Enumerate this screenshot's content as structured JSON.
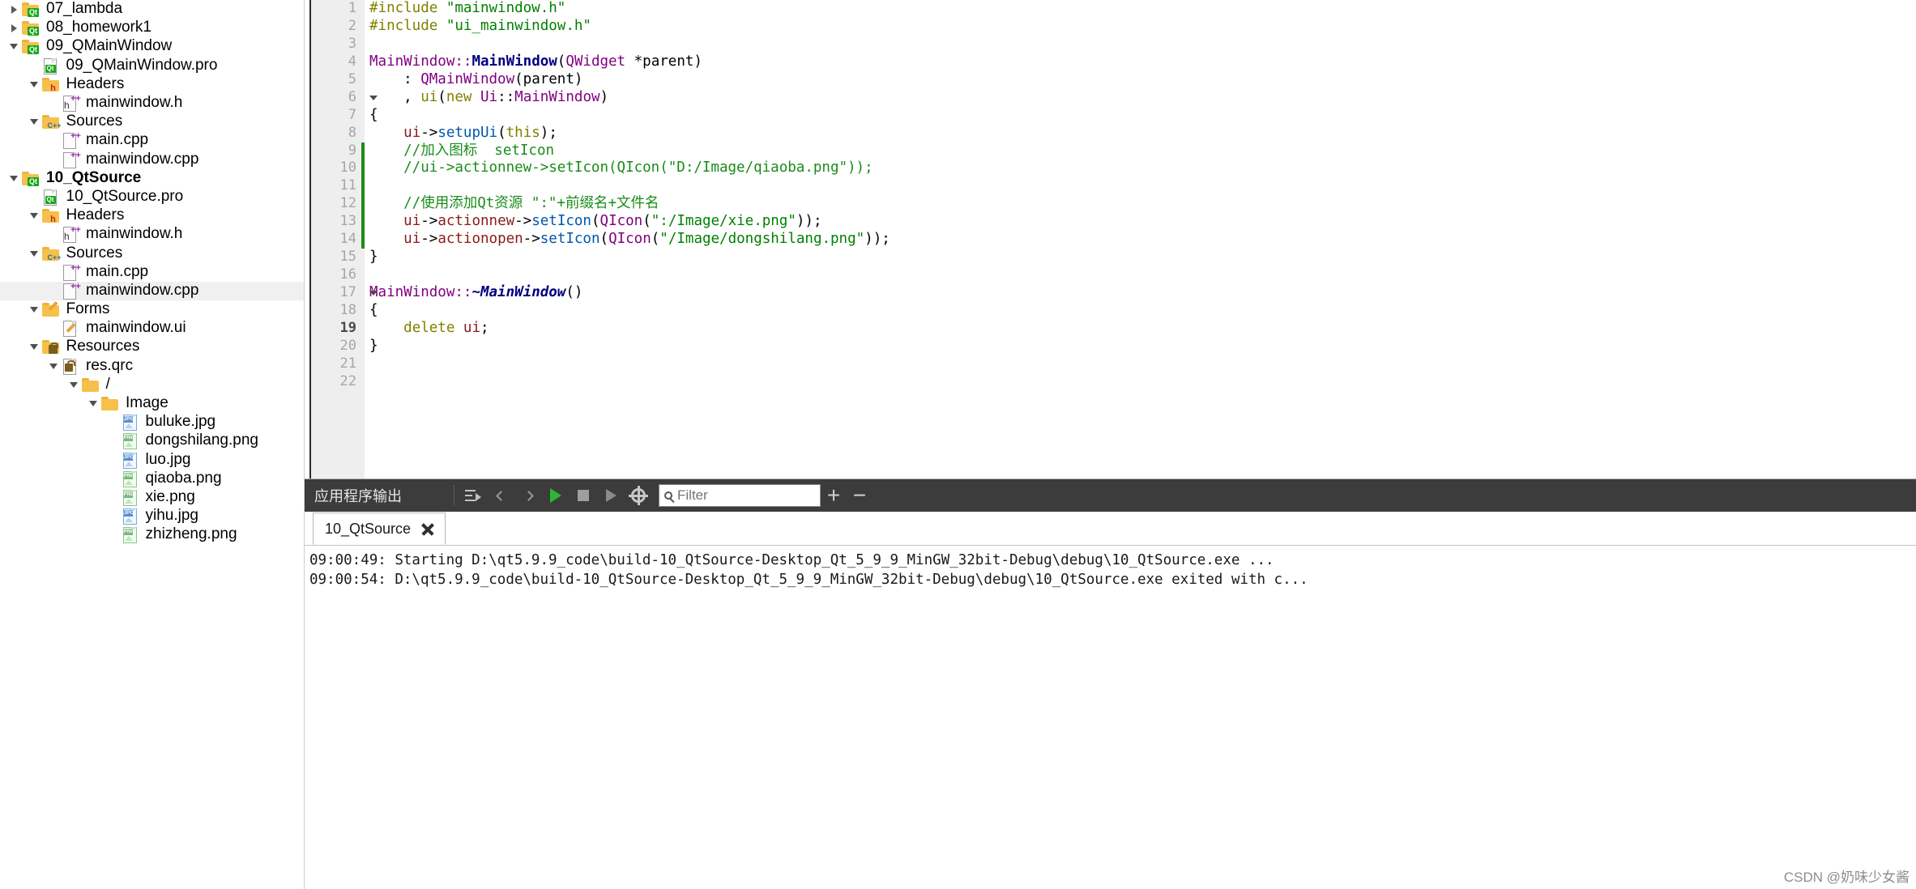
{
  "sidebar": {
    "name": "project-tree",
    "rows": [
      {
        "indent": 0,
        "arrow": "right",
        "icon": "folder-qt",
        "label": "07_lambda",
        "bold": false,
        "selected": false
      },
      {
        "indent": 0,
        "arrow": "right",
        "icon": "folder-qt",
        "label": "08_homework1",
        "bold": false,
        "selected": false
      },
      {
        "indent": 0,
        "arrow": "down",
        "icon": "folder-qt",
        "label": "09_QMainWindow",
        "bold": false,
        "selected": false
      },
      {
        "indent": 1,
        "arrow": "none",
        "icon": "doc-qt",
        "label": "09_QMainWindow.pro",
        "bold": false,
        "selected": false
      },
      {
        "indent": 1,
        "arrow": "down",
        "icon": "folder-h",
        "label": "Headers",
        "bold": false,
        "selected": false
      },
      {
        "indent": 2,
        "arrow": "none",
        "icon": "doc-h",
        "label": "mainwindow.h",
        "bold": false,
        "selected": false
      },
      {
        "indent": 1,
        "arrow": "down",
        "icon": "folder-cpp",
        "label": "Sources",
        "bold": false,
        "selected": false
      },
      {
        "indent": 2,
        "arrow": "none",
        "icon": "doc-cpp",
        "label": "main.cpp",
        "bold": false,
        "selected": false
      },
      {
        "indent": 2,
        "arrow": "none",
        "icon": "doc-cpp",
        "label": "mainwindow.cpp",
        "bold": false,
        "selected": false
      },
      {
        "indent": 0,
        "arrow": "down",
        "icon": "folder-qt",
        "label": "10_QtSource",
        "bold": true,
        "selected": false
      },
      {
        "indent": 1,
        "arrow": "none",
        "icon": "doc-qt",
        "label": "10_QtSource.pro",
        "bold": false,
        "selected": false
      },
      {
        "indent": 1,
        "arrow": "down",
        "icon": "folder-h",
        "label": "Headers",
        "bold": false,
        "selected": false
      },
      {
        "indent": 2,
        "arrow": "none",
        "icon": "doc-h",
        "label": "mainwindow.h",
        "bold": false,
        "selected": false
      },
      {
        "indent": 1,
        "arrow": "down",
        "icon": "folder-cpp",
        "label": "Sources",
        "bold": false,
        "selected": false
      },
      {
        "indent": 2,
        "arrow": "none",
        "icon": "doc-cpp",
        "label": "main.cpp",
        "bold": false,
        "selected": false
      },
      {
        "indent": 2,
        "arrow": "none",
        "icon": "doc-cpp",
        "label": "mainwindow.cpp",
        "bold": false,
        "selected": true
      },
      {
        "indent": 1,
        "arrow": "down",
        "icon": "folder-form",
        "label": "Forms",
        "bold": false,
        "selected": false
      },
      {
        "indent": 2,
        "arrow": "none",
        "icon": "doc-form",
        "label": "mainwindow.ui",
        "bold": false,
        "selected": false
      },
      {
        "indent": 1,
        "arrow": "down",
        "icon": "folder-res",
        "label": "Resources",
        "bold": false,
        "selected": false
      },
      {
        "indent": 2,
        "arrow": "down",
        "icon": "doc-res",
        "label": "res.qrc",
        "bold": false,
        "selected": false
      },
      {
        "indent": 3,
        "arrow": "down",
        "icon": "folder-plain",
        "label": "/",
        "bold": false,
        "selected": false
      },
      {
        "indent": 4,
        "arrow": "down",
        "icon": "folder-plain",
        "label": "Image",
        "bold": false,
        "selected": false
      },
      {
        "indent": 5,
        "arrow": "none",
        "icon": "img-jpg",
        "label": "buluke.jpg",
        "bold": false,
        "selected": false
      },
      {
        "indent": 5,
        "arrow": "none",
        "icon": "img-png",
        "label": "dongshilang.png",
        "bold": false,
        "selected": false
      },
      {
        "indent": 5,
        "arrow": "none",
        "icon": "img-jpg",
        "label": "luo.jpg",
        "bold": false,
        "selected": false
      },
      {
        "indent": 5,
        "arrow": "none",
        "icon": "img-png",
        "label": "qiaoba.png",
        "bold": false,
        "selected": false
      },
      {
        "indent": 5,
        "arrow": "none",
        "icon": "img-png",
        "label": "xie.png",
        "bold": false,
        "selected": false
      },
      {
        "indent": 5,
        "arrow": "none",
        "icon": "img-jpg",
        "label": "yihu.jpg",
        "bold": false,
        "selected": false
      },
      {
        "indent": 5,
        "arrow": "none",
        "icon": "img-png",
        "label": "zhizheng.png",
        "bold": false,
        "selected": false
      }
    ]
  },
  "editor": {
    "name": "code-editor",
    "file": "mainwindow.cpp",
    "current_line": 19,
    "change_bar_lines": [
      9,
      14
    ],
    "fold_markers": [
      6,
      17
    ],
    "line_count": 22,
    "lines": [
      {
        "n": 1,
        "tokens": [
          {
            "t": "#include ",
            "c": "pre"
          },
          {
            "t": "\"mainwindow.h\"",
            "c": "str"
          }
        ]
      },
      {
        "n": 2,
        "tokens": [
          {
            "t": "#include ",
            "c": "pre"
          },
          {
            "t": "\"ui_mainwindow.h\"",
            "c": "str"
          }
        ]
      },
      {
        "n": 3,
        "tokens": []
      },
      {
        "n": 4,
        "tokens": [
          {
            "t": "MainWindow",
            "c": "type"
          },
          {
            "t": "::",
            "c": "type"
          },
          {
            "t": "MainWindow",
            "c": "typeb"
          },
          {
            "t": "(",
            "c": "plain"
          },
          {
            "t": "QWidget ",
            "c": "type"
          },
          {
            "t": "*parent",
            "c": "plain"
          },
          {
            "t": ")",
            "c": "plain"
          }
        ]
      },
      {
        "n": 5,
        "tokens": [
          {
            "t": "    : ",
            "c": "plain"
          },
          {
            "t": "QMainWindow",
            "c": "type"
          },
          {
            "t": "(parent)",
            "c": "plain"
          }
        ]
      },
      {
        "n": 6,
        "tokens": [
          {
            "t": "    , ",
            "c": "plain"
          },
          {
            "t": "ui",
            "c": "fld"
          },
          {
            "t": "(",
            "c": "plain"
          },
          {
            "t": "new",
            "c": "kw"
          },
          {
            "t": " ",
            "c": "plain"
          },
          {
            "t": "Ui",
            "c": "type"
          },
          {
            "t": "::",
            "c": "plain"
          },
          {
            "t": "MainWindow",
            "c": "type"
          },
          {
            "t": ")",
            "c": "plain"
          }
        ]
      },
      {
        "n": 7,
        "tokens": [
          {
            "t": "{",
            "c": "plain"
          }
        ]
      },
      {
        "n": 8,
        "tokens": [
          {
            "t": "    ",
            "c": "plain"
          },
          {
            "t": "ui",
            "c": "var"
          },
          {
            "t": "->",
            "c": "plain"
          },
          {
            "t": "setupUi",
            "c": "fn"
          },
          {
            "t": "(",
            "c": "plain"
          },
          {
            "t": "this",
            "c": "fld"
          },
          {
            "t": ");",
            "c": "plain"
          }
        ]
      },
      {
        "n": 9,
        "tokens": [
          {
            "t": "    //加入图标  setIcon",
            "c": "cmt"
          }
        ]
      },
      {
        "n": 10,
        "tokens": [
          {
            "t": "    //ui->actionnew->setIcon(QIcon(\"D:/Image/qiaoba.png\"));",
            "c": "cmt"
          }
        ]
      },
      {
        "n": 11,
        "tokens": []
      },
      {
        "n": 12,
        "tokens": [
          {
            "t": "    //使用添加Qt资源 \":\"+前缀名+文件名",
            "c": "cmt"
          }
        ]
      },
      {
        "n": 13,
        "tokens": [
          {
            "t": "    ",
            "c": "plain"
          },
          {
            "t": "ui",
            "c": "var"
          },
          {
            "t": "->",
            "c": "plain"
          },
          {
            "t": "actionnew",
            "c": "var"
          },
          {
            "t": "->",
            "c": "plain"
          },
          {
            "t": "setIcon",
            "c": "fn"
          },
          {
            "t": "(",
            "c": "plain"
          },
          {
            "t": "QIcon",
            "c": "type"
          },
          {
            "t": "(",
            "c": "plain"
          },
          {
            "t": "\":/Image/xie.png\"",
            "c": "str"
          },
          {
            "t": "));",
            "c": "plain"
          }
        ]
      },
      {
        "n": 14,
        "tokens": [
          {
            "t": "    ",
            "c": "plain"
          },
          {
            "t": "ui",
            "c": "var"
          },
          {
            "t": "->",
            "c": "plain"
          },
          {
            "t": "actionopen",
            "c": "var"
          },
          {
            "t": "->",
            "c": "plain"
          },
          {
            "t": "setIcon",
            "c": "fn"
          },
          {
            "t": "(",
            "c": "plain"
          },
          {
            "t": "QIcon",
            "c": "type"
          },
          {
            "t": "(",
            "c": "plain"
          },
          {
            "t": "\"/Image/dongshilang.png\"",
            "c": "str"
          },
          {
            "t": "));",
            "c": "plain"
          }
        ]
      },
      {
        "n": 15,
        "tokens": [
          {
            "t": "}",
            "c": "plain"
          }
        ]
      },
      {
        "n": 16,
        "tokens": []
      },
      {
        "n": 17,
        "tokens": [
          {
            "t": "MainWindow",
            "c": "type"
          },
          {
            "t": "::",
            "c": "type"
          },
          {
            "t": "~MainWindow",
            "c": "dtor"
          },
          {
            "t": "()",
            "c": "plain"
          }
        ]
      },
      {
        "n": 18,
        "tokens": [
          {
            "t": "{",
            "c": "plain"
          }
        ]
      },
      {
        "n": 19,
        "tokens": [
          {
            "t": "    ",
            "c": "plain"
          },
          {
            "t": "delete",
            "c": "kw"
          },
          {
            "t": " ",
            "c": "plain"
          },
          {
            "t": "ui",
            "c": "var"
          },
          {
            "t": ";",
            "c": "plain"
          }
        ]
      },
      {
        "n": 20,
        "tokens": [
          {
            "t": "}",
            "c": "plain"
          }
        ]
      },
      {
        "n": 21,
        "tokens": []
      },
      {
        "n": 22,
        "tokens": []
      }
    ]
  },
  "output": {
    "name": "application-output",
    "title": "应用程序输出",
    "toolbar": {
      "export_icon": "export-icon",
      "prev_icon": "chevron-left-icon",
      "next_icon": "chevron-right-icon",
      "run_icon": "play-icon",
      "stop_icon": "stop-icon",
      "debug_icon": "debug-run-icon",
      "settings_icon": "gear-icon",
      "filter_icon": "search-icon",
      "filter_placeholder": "Filter",
      "filter_value": "",
      "zoom_in_label": "+",
      "zoom_out_label": "−"
    },
    "tabs": [
      {
        "label": "10_QtSource",
        "close_icon": "close-icon",
        "active": true
      }
    ],
    "console_lines": [
      "09:00:49: Starting D:\\qt5.9.9_code\\build-10_QtSource-Desktop_Qt_5_9_9_MinGW_32bit-Debug\\debug\\10_QtSource.exe ...",
      "09:00:54: D:\\qt5.9.9_code\\build-10_QtSource-Desktop_Qt_5_9_9_MinGW_32bit-Debug\\debug\\10_QtSource.exe exited with c..."
    ]
  },
  "watermark": {
    "text": "CSDN @奶味少女酱"
  },
  "colors": {
    "accent_green": "#1a8c1a",
    "toolbar_bg": "#3c3c3c",
    "gutter_bg": "#eeeeee",
    "selection_bg": "#f0f0f0",
    "qt_green": "#17a81a"
  }
}
